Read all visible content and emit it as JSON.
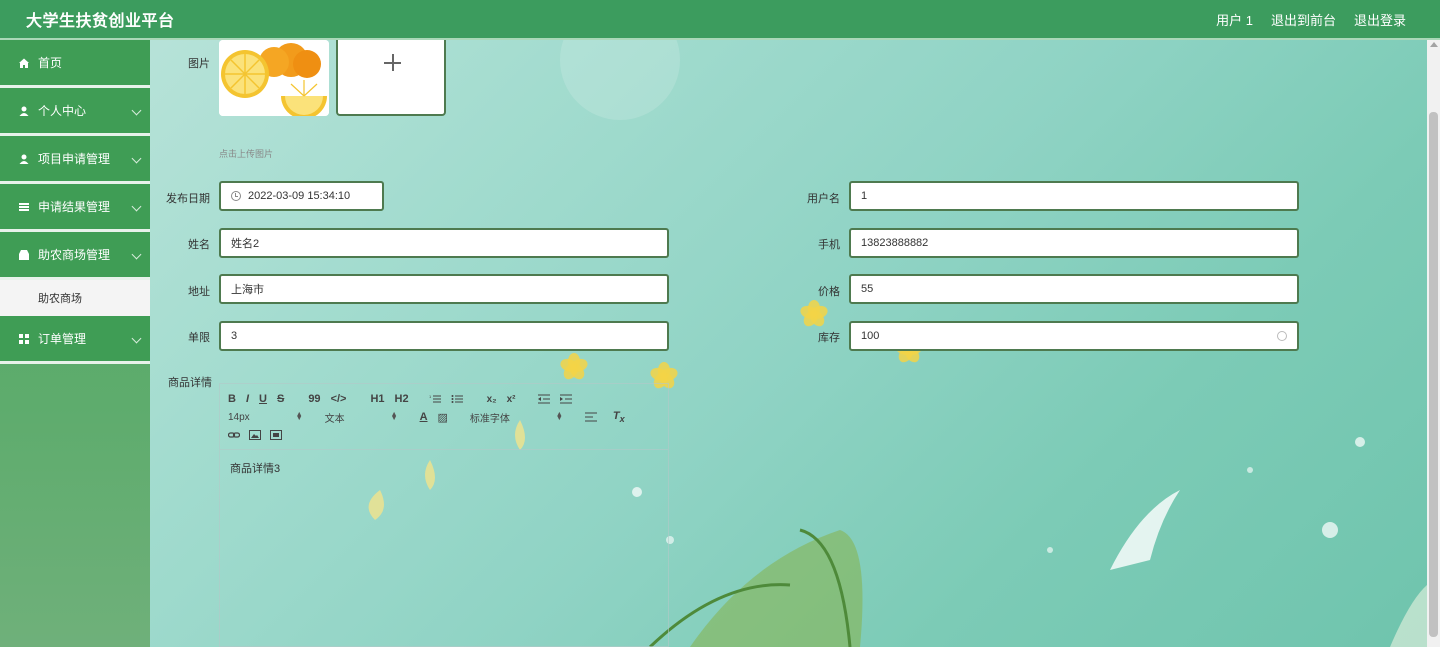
{
  "header": {
    "brand": "大学生扶贫创业平台",
    "user": "用户 1",
    "back_front": "退出到前台",
    "logout": "退出登录"
  },
  "sidebar": {
    "items": [
      {
        "label": "首页",
        "icon": "home-icon"
      },
      {
        "label": "个人中心",
        "icon": "user-icon"
      },
      {
        "label": "项目申请管理",
        "icon": "user-icon"
      },
      {
        "label": "申请结果管理",
        "icon": "stack-icon"
      },
      {
        "label": "助农商场管理",
        "icon": "shop-icon"
      },
      {
        "label": "助农商场",
        "icon": ""
      },
      {
        "label": "订单管理",
        "icon": "grid-icon"
      }
    ]
  },
  "form": {
    "image_label": "图片",
    "upload_hint": "点击上传图片",
    "publish_date_label": "发布日期",
    "publish_date_value": "2022-03-09 15:34:10",
    "username_label": "用户名",
    "username_value": "1",
    "name_label": "姓名",
    "name_value": "姓名2",
    "phone_label": "手机",
    "phone_value": "13823888882",
    "address_label": "地址",
    "address_value": "上海市",
    "price_label": "价格",
    "price_value": "55",
    "limit_label": "单限",
    "limit_value": "3",
    "stock_label": "库存",
    "stock_value": "100",
    "detail_label": "商品详情"
  },
  "editor": {
    "font_size": "14px",
    "text_style": "文本",
    "font_family": "标准字体",
    "content": "商品详情3",
    "buttons": [
      "B",
      "I",
      "U",
      "S",
      "99",
      "</>",
      "H1",
      "H2"
    ]
  }
}
